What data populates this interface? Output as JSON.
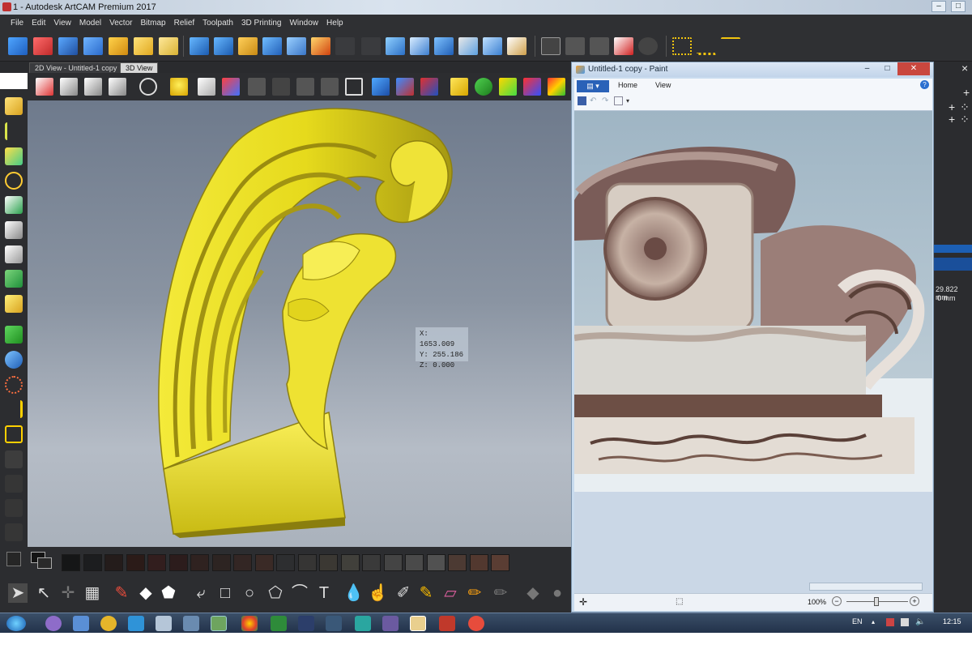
{
  "window": {
    "title": "1 - Autodesk ArtCAM Premium 2017"
  },
  "menu": [
    "File",
    "Edit",
    "View",
    "Model",
    "Vector",
    "Bitmap",
    "Relief",
    "Toolpath",
    "3D Printing",
    "Window",
    "Help"
  ],
  "tabs": [
    {
      "label": "2D View - Untitled-1 copy",
      "active": false
    },
    {
      "label": "3D View",
      "active": true
    }
  ],
  "viewport": {
    "readout": {
      "x": "X: 1653.009",
      "y": "Y: 255.186",
      "z": "Z: 0.000"
    },
    "model_color": "#e8dc1f",
    "background_top": "#6e7a8c",
    "background_bottom": "#aab2bc"
  },
  "palette_colors": [
    "#151617",
    "#1c1d1f",
    "#241c1b",
    "#2b1b18",
    "#321e1e",
    "#2c1c1c",
    "#2f2220",
    "#2d2422",
    "#332624",
    "#3a2a26",
    "#2d2e30",
    "#363534",
    "#3b3833",
    "#41403b",
    "#3a3a3a",
    "#444444",
    "#4a4a4a",
    "#515151",
    "#4c3a33",
    "#52382f",
    "#5a3d33"
  ],
  "paint": {
    "title": "Untitled-1 copy - Paint",
    "tabs": [
      "Home",
      "View"
    ],
    "zoom": "100%"
  },
  "right_panel": {
    "value1": "29.822 mm",
    "value2": "0 mm"
  },
  "taskbar": {
    "lang": "EN",
    "time": "12:15"
  }
}
